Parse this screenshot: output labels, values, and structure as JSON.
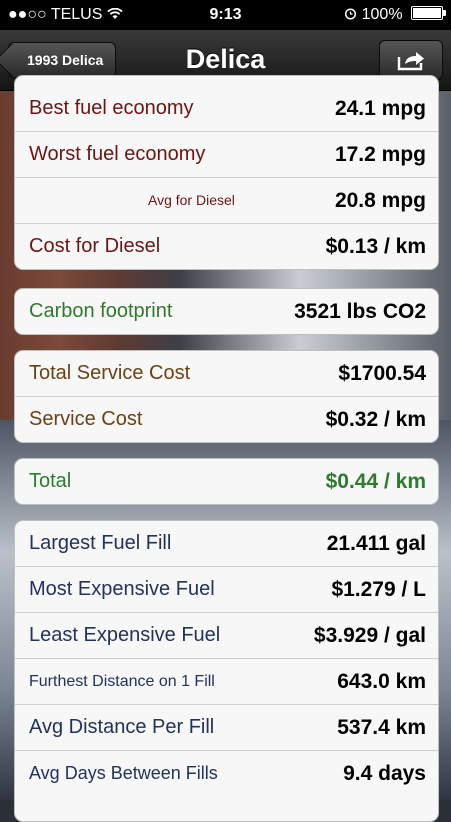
{
  "status_bar": {
    "carrier": "●●○○ TELUS",
    "time": "9:13",
    "battery": "100%"
  },
  "nav": {
    "back_label": "1993 Delica",
    "title": "Delica"
  },
  "fuel_group": {
    "rows": [
      {
        "label": "Best fuel economy",
        "value": "24.1 mpg"
      },
      {
        "label": "Worst fuel economy",
        "value": "17.2 mpg"
      },
      {
        "label": "Avg for Diesel",
        "value": "20.8 mpg"
      },
      {
        "label": "Cost for Diesel",
        "value": "$0.13 / km"
      }
    ]
  },
  "carbon_group": {
    "rows": [
      {
        "label": "Carbon footprint",
        "value": "3521 lbs CO2"
      }
    ]
  },
  "service_group": {
    "rows": [
      {
        "label": "Total Service Cost",
        "value": "$1700.54"
      },
      {
        "label": "Service Cost",
        "value": "$0.32 / km"
      }
    ]
  },
  "total_group": {
    "rows": [
      {
        "label": "Total",
        "value": "$0.44 / km"
      }
    ]
  },
  "fill_group": {
    "rows": [
      {
        "label": "Largest Fuel Fill",
        "value": "21.411 gal"
      },
      {
        "label": "Most Expensive Fuel",
        "value": "$1.279 / L"
      },
      {
        "label": "Least Expensive Fuel",
        "value": "$3.929 / gal"
      },
      {
        "label": "Furthest Distance on 1 Fill",
        "value": "643.0 km"
      },
      {
        "label": "Avg Distance Per Fill",
        "value": "537.4 km"
      },
      {
        "label": "Avg Days Between Fills",
        "value": "9.4 days"
      }
    ]
  },
  "colors": {
    "fuel_label": "#6b1515",
    "carbon_label": "#2e7a2e",
    "service_label": "#6a4215",
    "fill_label": "#22335a"
  },
  "icons": {
    "wifi": "wifi-icon",
    "alarm": "alarm-icon",
    "share": "share-icon"
  }
}
